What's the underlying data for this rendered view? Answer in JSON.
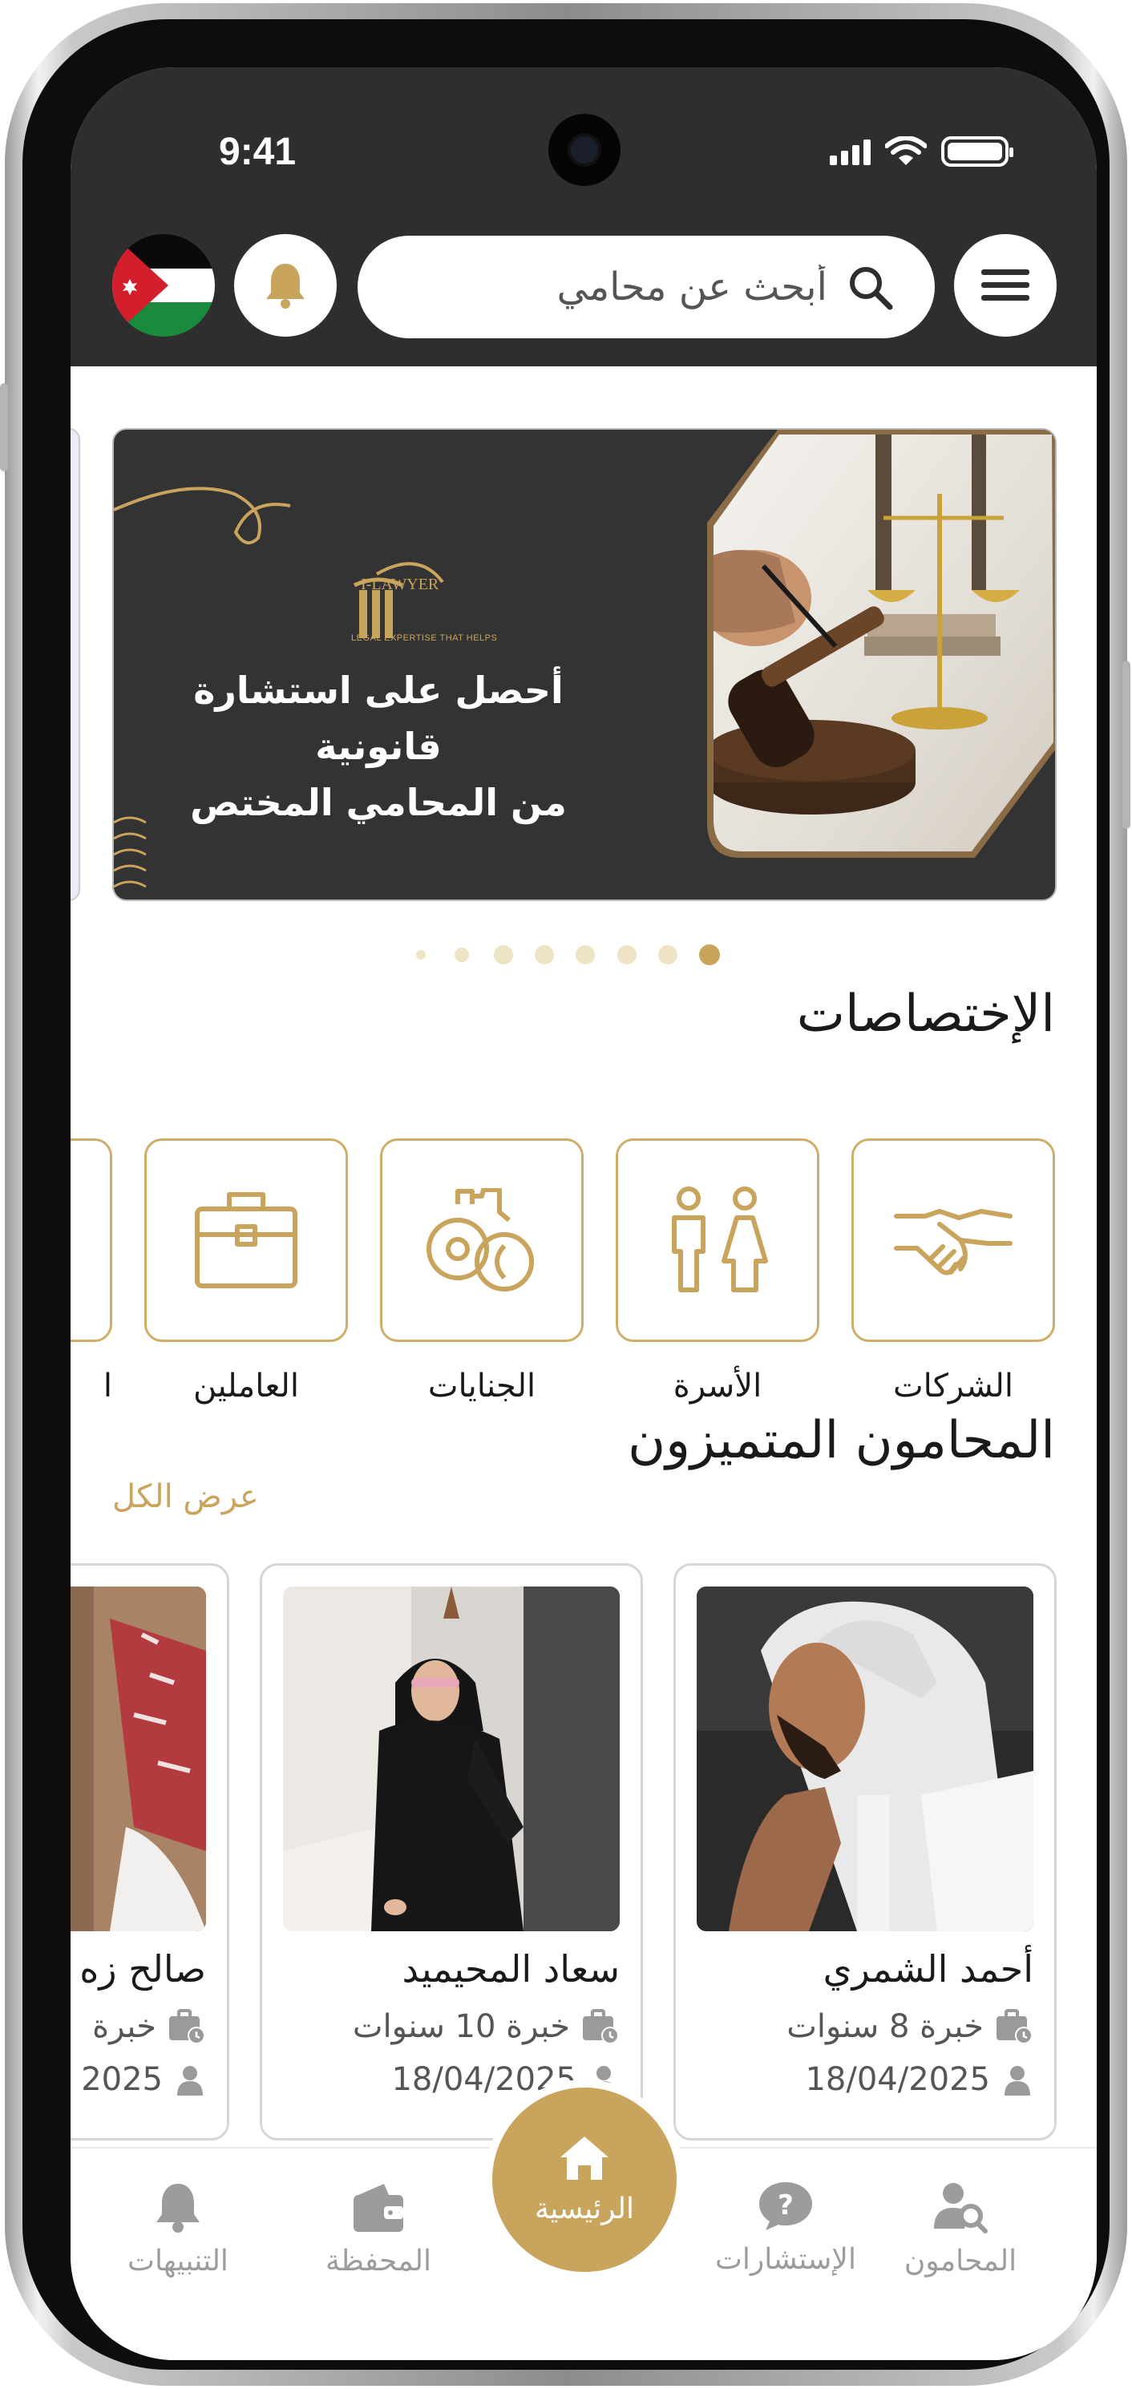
{
  "status_bar": {
    "time": "9:41"
  },
  "header": {
    "search_placeholder": "أبحث عن محامي"
  },
  "banner": {
    "logo_name": "I-LAWYER",
    "logo_tagline": "LEGAL EXPERTISE THAT HELPS",
    "title_line1": "أحصل على استشارة قانونية",
    "title_line2": "من المحامي المختص",
    "dot_count": 8,
    "active_dot": 8
  },
  "specialties": {
    "title": "الإختصاصات",
    "items": [
      {
        "label": "الشركات",
        "icon": "handshake-icon"
      },
      {
        "label": "الأسرة",
        "icon": "family-icon"
      },
      {
        "label": "الجنايات",
        "icon": "handcuffs-icon"
      },
      {
        "label": "العاملين",
        "icon": "briefcase-icon"
      },
      {
        "label": "ا",
        "icon": ""
      }
    ]
  },
  "lawyers": {
    "title": "المحامون المتميزون",
    "view_all": "عرض الكل",
    "items": [
      {
        "name": "أحمد الشمري",
        "experience": "خبرة 8 سنوات",
        "date": "18/04/2025"
      },
      {
        "name": "سعاد المحيميد",
        "experience": "خبرة 10 سنوات",
        "date": "18/04/2025"
      },
      {
        "name": "صالح زه",
        "experience": "خبرة",
        "date": "2025"
      }
    ]
  },
  "bottom_nav": {
    "home": "الرئيسية",
    "lawyers": "المحامون",
    "consultations": "الإستشارات",
    "wallet": "المحفظة",
    "notifications": "التنبيهات"
  },
  "colors": {
    "gold": "#c9a45c",
    "dark": "#2e2e2e",
    "inactive": "#9c9c9c"
  }
}
